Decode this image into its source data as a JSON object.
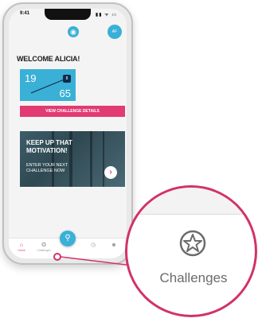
{
  "status": {
    "time": "9:41",
    "icons": "▮▮ ᯤ ▭"
  },
  "header": {
    "avatar_initials": "AF"
  },
  "home": {
    "welcome": "WELCOME ALICIA!",
    "stats": {
      "value_a": "19",
      "value_b": "65",
      "badge": "8"
    },
    "view_button": "VIEW CHALLENGE DETAILS",
    "promo": {
      "title": "KEEP UP THAT MOTIVATION!",
      "subtitle": "ENTER YOUR NEXT CHALLENGE NOW",
      "arrow": "›"
    }
  },
  "tabbar": {
    "items": [
      {
        "label": "Home",
        "icon": "home-icon",
        "active": true
      },
      {
        "label": "Challenges",
        "icon": "star-badge-icon",
        "active": false
      },
      {
        "label": "",
        "icon": "location-pin-icon",
        "active": false
      },
      {
        "label": "",
        "icon": "clock-icon",
        "active": false
      },
      {
        "label": "",
        "icon": "people-icon",
        "active": false
      }
    ]
  },
  "magnifier": {
    "label": "Challenges",
    "icon": "star-badge-icon"
  },
  "colors": {
    "brand_blue": "#3ab0d6",
    "brand_pink": "#e23a72",
    "dark_navy": "#102a4a"
  }
}
